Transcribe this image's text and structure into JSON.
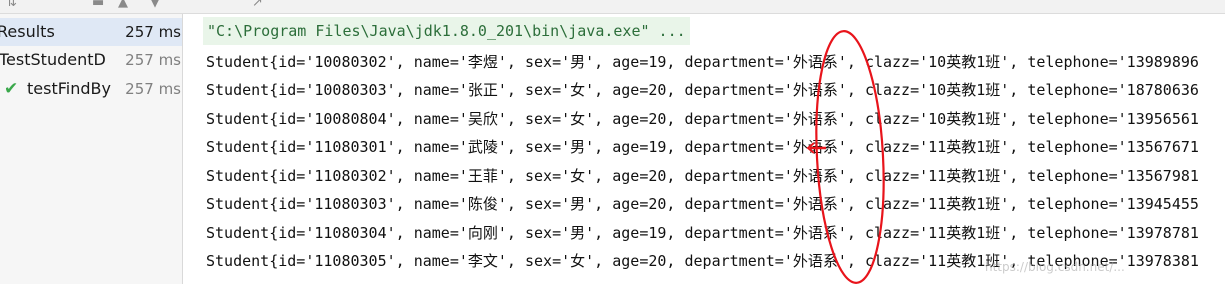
{
  "toolbar": {
    "icons": [
      "sort-icon",
      "minus-icon",
      "up-arrow-icon",
      "down-arrow-icon",
      "export-icon"
    ]
  },
  "tree": {
    "rows": [
      {
        "label": "Results",
        "time": "257 ms"
      },
      {
        "label": "TestStudentD",
        "time": "257 ms"
      },
      {
        "label": "testFindBy",
        "time": "257 ms"
      }
    ]
  },
  "console": {
    "command": "\"C:\\Program Files\\Java\\jdk1.8.0_201\\bin\\java.exe\" ...",
    "lines": [
      "Student{id='10080302', name='李煜', sex='男', age=19, department='外语系', clazz='10英教1班', telephone='13989896",
      "Student{id='10080303', name='张正', sex='女', age=20, department='外语系', clazz='10英教1班', telephone='18780636",
      "Student{id='10080804', name='吴欣', sex='女', age=20, department='外语系', clazz='10英教1班', telephone='13956561",
      "Student{id='11080301', name='武陵', sex='男', age=19, department='外语系', clazz='11英教1班', telephone='13567671",
      "Student{id='11080302', name='王菲', sex='女', age=20, department='外语系', clazz='11英教1班', telephone='13567981",
      "Student{id='11080303', name='陈俊', sex='男', age=20, department='外语系', clazz='11英教1班', telephone='13945455",
      "Student{id='11080304', name='向刚', sex='男', age=19, department='外语系', clazz='11英教1班', telephone='13978781",
      "Student{id='11080305', name='李文', sex='女', age=20, department='外语系', clazz='11英教1班', telephone='13978381"
    ]
  },
  "watermark": "https://blog.csdn.net/...",
  "colors": {
    "pass_check": "#3aa84b",
    "annotation": "#e8141b",
    "selected_row": "#dfe8f5",
    "command_bg": "#e9f5e9"
  }
}
